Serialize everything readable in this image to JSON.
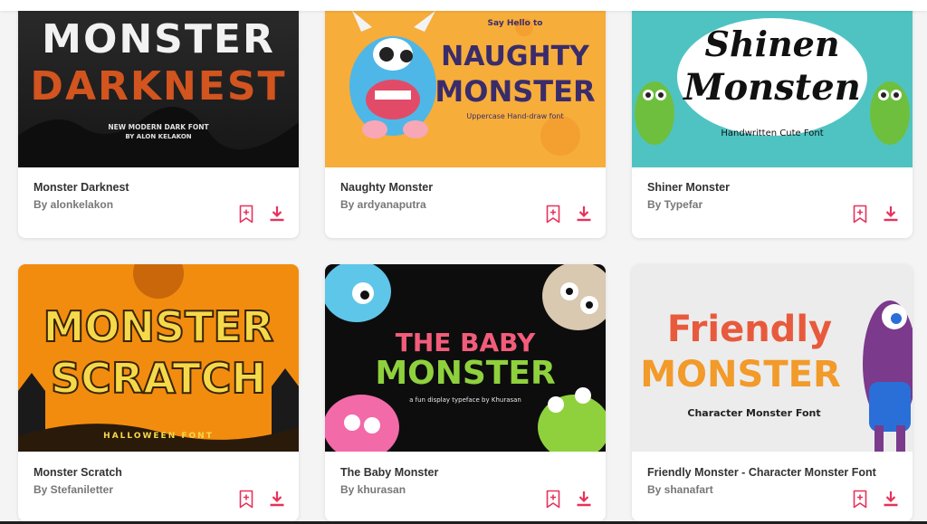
{
  "colors": {
    "accent": "#e8315a",
    "card_bg": "#ffffff",
    "page_bg": "#f4f4f5"
  },
  "cards": [
    {
      "title": "Monster Darknest",
      "author": "By alonkelakon",
      "thumb": {
        "line1": "MONSTER",
        "line2": "DARKNEST",
        "tag": "NEW MODERN DARK FONT",
        "by": "BY ALON KELAKON"
      }
    },
    {
      "title": "Naughty Monster",
      "author": "By ardyanaputra",
      "thumb": {
        "hello": "Say Hello to",
        "line1": "NAUGHTY",
        "line2": "MONSTER",
        "tag": "Uppercase Hand-draw font"
      }
    },
    {
      "title": "Shiner Monster",
      "author": "By Typefar",
      "thumb": {
        "line1": "Shinen",
        "line2": "Monsten",
        "tag": "Handwritten Cute Font"
      }
    },
    {
      "title": "Monster Scratch",
      "author": "By Stefaniletter",
      "thumb": {
        "line1": "MONSTER",
        "line2": "SCRATCH",
        "tag": "HALLOWEEN FONT"
      }
    },
    {
      "title": "The Baby Monster",
      "author": "By khurasan",
      "thumb": {
        "line1": "THE BABY",
        "line2": "MONSTER",
        "tag": "a fun display typeface by Khurasan"
      }
    },
    {
      "title": "Friendly Monster - Character Monster Font",
      "author": "By shanafart",
      "thumb": {
        "line1": "Friendly",
        "line2": "MONSTER",
        "tag": "Character Monster Font"
      }
    }
  ]
}
